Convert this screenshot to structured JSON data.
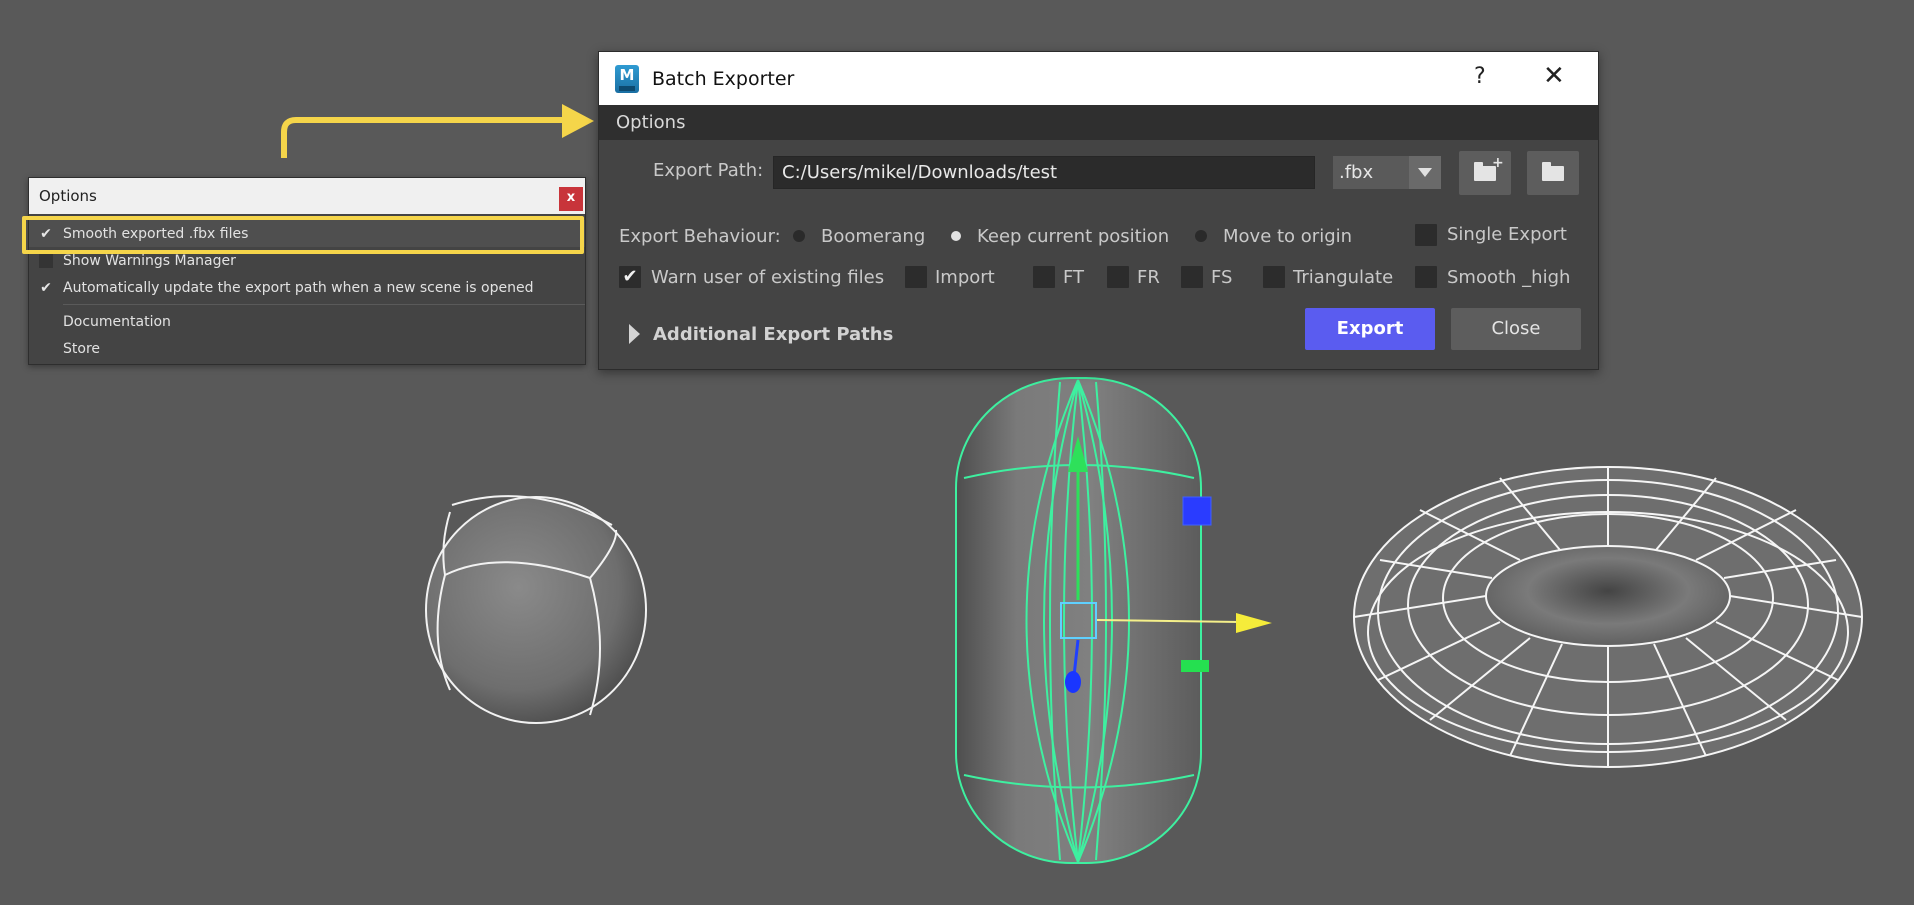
{
  "options_popup": {
    "title": "Options",
    "close_glyph": "x",
    "items": [
      {
        "label": "Smooth exported .fbx files",
        "checked": true
      },
      {
        "label": "Show Warnings Manager",
        "checked": false
      },
      {
        "label": "Automatically update the export path when a new scene is opened",
        "checked": true
      }
    ],
    "links": [
      {
        "label": "Documentation"
      },
      {
        "label": "Store"
      }
    ]
  },
  "batch_exporter": {
    "icon_letter": "M",
    "title": "Batch Exporter",
    "help_glyph": "?",
    "close_glyph": "✕",
    "section_title": "Options",
    "export_path_label": "Export Path:",
    "export_path_value": "C:/Users/mikel/Downloads/test",
    "extension": ".fbx",
    "behaviour_label": "Export Behaviour:",
    "behaviour_options": [
      {
        "label": "Boomerang",
        "selected": false
      },
      {
        "label": "Keep current position",
        "selected": true
      },
      {
        "label": "Move to origin",
        "selected": false
      }
    ],
    "single_export": {
      "label": "Single Export",
      "checked": false
    },
    "checkboxes": [
      {
        "label": "Warn user of existing files",
        "checked": true
      },
      {
        "label": "Import",
        "checked": false
      },
      {
        "label": "FT",
        "checked": false
      },
      {
        "label": "FR",
        "checked": false
      },
      {
        "label": "FS",
        "checked": false
      },
      {
        "label": "Triangulate",
        "checked": false
      },
      {
        "label": "Smooth _high",
        "checked": false
      }
    ],
    "additional_paths_label": "Additional Export Paths",
    "export_button": "Export",
    "close_button": "Close"
  },
  "colors": {
    "viewport": "#595959",
    "highlight": "#f5d54a",
    "export_accent": "#5a5cf0",
    "selection_wire": "#3ef0a0",
    "close_red": "#c8343a"
  },
  "icons": [
    "maya-app-icon",
    "help-icon",
    "close-icon",
    "new-folder-icon",
    "open-folder-icon",
    "checkmark-icon",
    "expand-arrow-icon"
  ]
}
